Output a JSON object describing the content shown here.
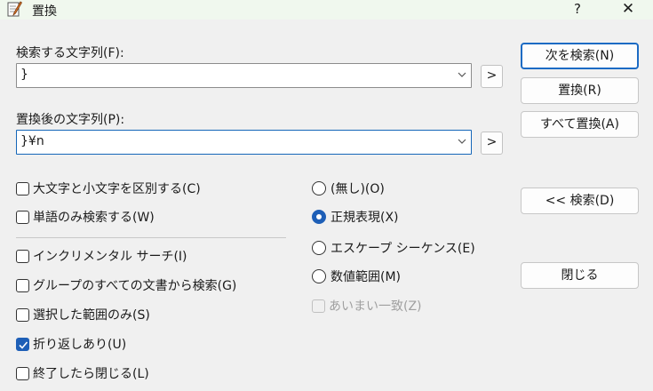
{
  "window": {
    "title": "置換",
    "help_label": "?",
    "close_label": "✕"
  },
  "find": {
    "label": "検索する文字列(F):",
    "value": "}",
    "expand_label": ">"
  },
  "replace": {
    "label": "置換後の文字列(P):",
    "value": "}¥n",
    "expand_label": ">"
  },
  "options": {
    "case_sensitive": {
      "label": "大文字と小文字を区別する(C)",
      "checked": false
    },
    "whole_word": {
      "label": "単語のみ検索する(W)",
      "checked": false
    },
    "incremental": {
      "label": "インクリメンタル サーチ(I)",
      "checked": false
    },
    "group_all": {
      "label": "グループのすべての文書から検索(G)",
      "checked": false
    },
    "selection_only": {
      "label": "選択した範囲のみ(S)",
      "checked": false
    },
    "wrap": {
      "label": "折り返しあり(U)",
      "checked": true
    },
    "close_on_done": {
      "label": "終了したら閉じる(L)",
      "checked": false
    }
  },
  "modes": {
    "none": {
      "label": "(無し)(O)",
      "selected": false
    },
    "regex": {
      "label": "正規表現(X)",
      "selected": true
    },
    "escape": {
      "label": "エスケープ シーケンス(E)",
      "selected": false
    },
    "numeric": {
      "label": "数値範囲(M)",
      "selected": false
    },
    "fuzzy": {
      "label": "あいまい一致(Z)",
      "checked": false,
      "disabled": true
    }
  },
  "buttons": {
    "find_next": "次を検索(N)",
    "replace": "置換(R)",
    "replace_all": "すべて置換(A)",
    "find_prev": "<< 検索(D)",
    "close": "閉じる"
  },
  "colors": {
    "accent": "#1e5fb7",
    "titlebar": "#f0f8ee"
  }
}
